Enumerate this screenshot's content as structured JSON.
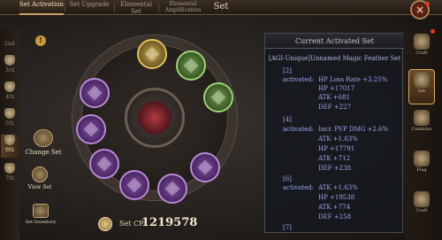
{
  "window": {
    "title": "Set",
    "close_glyph": "×"
  },
  "tabs": [
    {
      "label": "Set Activation",
      "active": true
    },
    {
      "label": "Set Upgrade",
      "active": false
    },
    {
      "label": "Elemental Set",
      "active": false
    },
    {
      "label": "Elemental Amplification",
      "active": false
    }
  ],
  "levels": {
    "top_label": "2nd",
    "items": [
      {
        "label": "3rd"
      },
      {
        "label": "4th"
      },
      {
        "label": "5th"
      },
      {
        "label": "6th",
        "active": true
      },
      {
        "label": "7th"
      }
    ]
  },
  "warning_badge": "!",
  "actions": {
    "change_set": "Change Set",
    "view_set": "View Set",
    "set_inventory": "Set Inventory"
  },
  "combat_power": {
    "label": "Set CP",
    "value": "1219578"
  },
  "panel": {
    "header": "Current Activated Set",
    "set_name": "[AGI-Unique]Unnamed Magic Feather Set",
    "groups": [
      {
        "count": "[2]",
        "activated": "activated:",
        "stats": [
          "HP Loss Rate +3.25%",
          "HP +17017",
          "ATK +681",
          "DEF +227"
        ]
      },
      {
        "count": "[4]",
        "activated": "activated:",
        "stats": [
          "Incr. PVP DMG +2.6%",
          "ATK +1.63%",
          "HP +17791",
          "ATK +712",
          "DEF +238"
        ]
      },
      {
        "count": "[6]",
        "activated": "activated:",
        "stats": [
          "ATK +1.63%",
          "HP +19538",
          "ATK +774",
          "DEF +258"
        ]
      },
      {
        "count": "[7]"
      }
    ]
  },
  "right_nav": [
    {
      "label": "Craft",
      "icon": "anvil-icon"
    },
    {
      "label": "Set",
      "icon": "set-icon",
      "active": true
    },
    {
      "label": "Combine",
      "icon": "combine-icon"
    },
    {
      "label": "Flag",
      "icon": "flag-icon"
    },
    {
      "label": "Craft",
      "icon": "craft-icon"
    }
  ],
  "colors": {
    "accent": "#c9a063",
    "stat_text": "#9aa8f0",
    "set_name": "#aeb6e8"
  }
}
